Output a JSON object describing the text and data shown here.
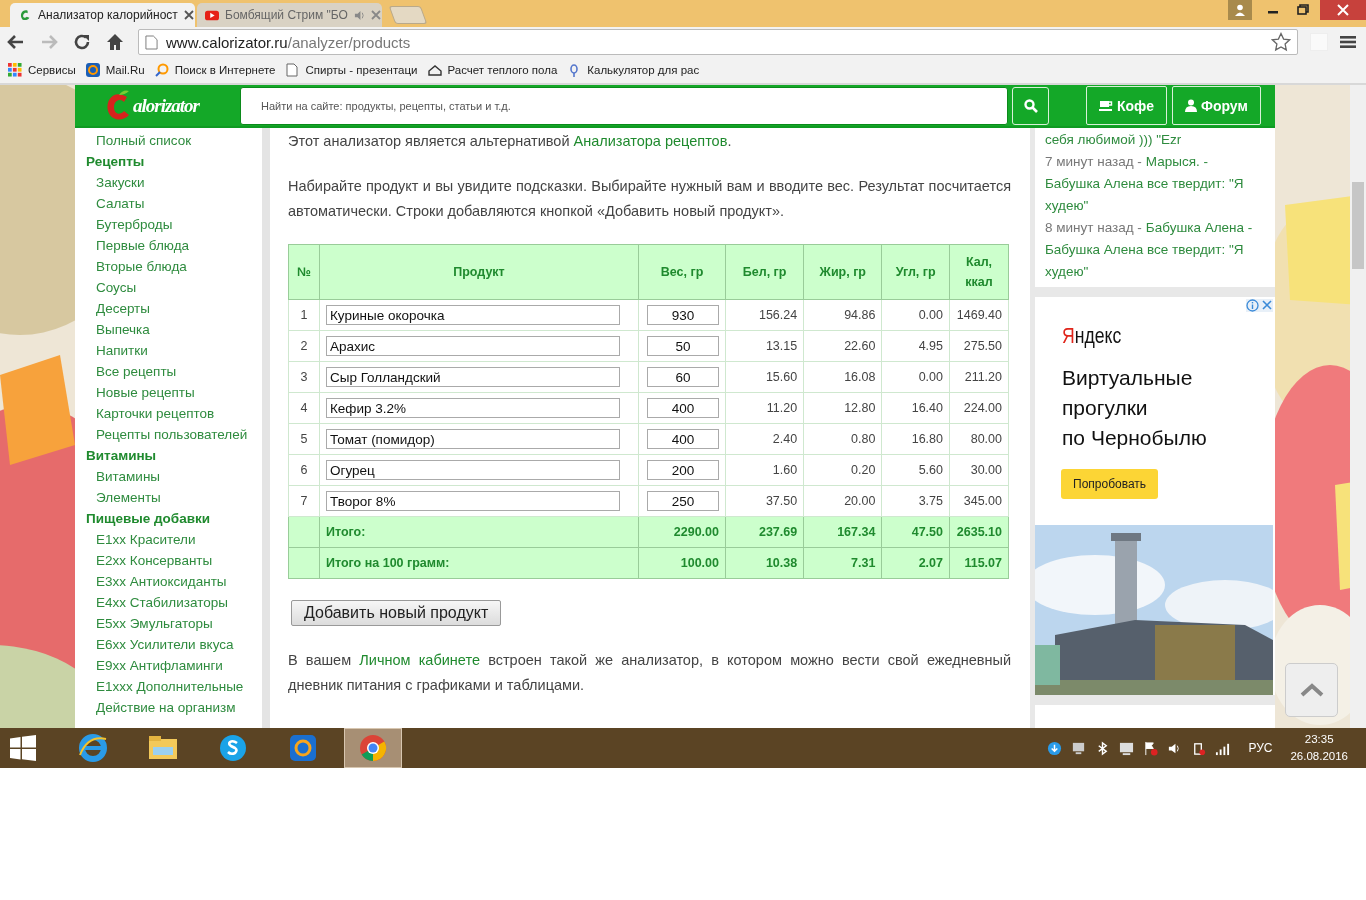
{
  "browser": {
    "tabs": [
      {
        "title": "Анализатор калорийност",
        "selected": true,
        "kind": "site",
        "audio": false
      },
      {
        "title": "Бомбящий Стрим \"БО",
        "selected": false,
        "kind": "video",
        "audio": true
      }
    ],
    "url": {
      "host": "www.calorizator.ru",
      "path": "/analyzer/products"
    },
    "bookmarks": [
      {
        "label": "Сервисы",
        "kind": "apps"
      },
      {
        "label": "Mail.Ru",
        "kind": "mail"
      },
      {
        "label": "Поиск в Интернете",
        "kind": "search"
      },
      {
        "label": "Спирты - презентаци",
        "kind": "doc"
      },
      {
        "label": "Расчет теплого пола",
        "kind": "floor"
      },
      {
        "label": "Калькулятор для рас",
        "kind": "pin"
      }
    ]
  },
  "site": {
    "logo_text": "alorizator",
    "search_placeholder": "Найти на сайте: продукты, рецепты, статьи и т.д.",
    "buttons": [
      {
        "label": "Кофе",
        "kind": "coffee"
      },
      {
        "label": "Форум",
        "kind": "user"
      }
    ]
  },
  "sidebar": [
    {
      "label": "Полный список",
      "kind": "link"
    },
    {
      "label": "Рецепты",
      "kind": "heading"
    },
    {
      "label": "Закуски",
      "kind": "link"
    },
    {
      "label": "Салаты",
      "kind": "link"
    },
    {
      "label": "Бутерброды",
      "kind": "link"
    },
    {
      "label": "Первые блюда",
      "kind": "link"
    },
    {
      "label": "Вторые блюда",
      "kind": "link"
    },
    {
      "label": "Соусы",
      "kind": "link"
    },
    {
      "label": "Десерты",
      "kind": "link"
    },
    {
      "label": "Выпечка",
      "kind": "link"
    },
    {
      "label": "Напитки",
      "kind": "link"
    },
    {
      "label": "Все рецепты",
      "kind": "link"
    },
    {
      "label": "Новые рецепты",
      "kind": "link"
    },
    {
      "label": "Карточки рецептов",
      "kind": "link"
    },
    {
      "label": "Рецепты пользователей",
      "kind": "link"
    },
    {
      "label": "Витамины",
      "kind": "heading"
    },
    {
      "label": "Витамины",
      "kind": "link"
    },
    {
      "label": "Элементы",
      "kind": "link"
    },
    {
      "label": "Пищевые добавки",
      "kind": "heading"
    },
    {
      "label": "E1xx Красители",
      "kind": "link"
    },
    {
      "label": "E2xx Консерванты",
      "kind": "link"
    },
    {
      "label": "E3xx Антиоксиданты",
      "kind": "link"
    },
    {
      "label": "E4xx Стабилизаторы",
      "kind": "link"
    },
    {
      "label": "E5xx Эмульгаторы",
      "kind": "link"
    },
    {
      "label": "E6xx Усилители вкуса",
      "kind": "link"
    },
    {
      "label": "E9xx Антифламинги",
      "kind": "link"
    },
    {
      "label": "E1xxx Дополнительные",
      "kind": "link"
    },
    {
      "label": "Действие на организм",
      "kind": "link"
    }
  ],
  "main": {
    "intro": {
      "before": "Этот анализатор является альтернативой ",
      "link": "Анализатора рецептов",
      "after": "."
    },
    "paragraph": "Набирайте продукт и вы увидите подсказки. Выбирайте нужный вам и вводите вес. Результат посчитается автоматически. Строки добавляются кнопкой «Добавить новый продукт».",
    "table": {
      "columns": [
        "№",
        "Продукт",
        "Вес, гр",
        "Бел, гр",
        "Жир, гр",
        "Угл, гр",
        "Кал, ккал"
      ],
      "rows": [
        {
          "num": "1",
          "product": "Куриные окорочка",
          "weight": "930",
          "protein": "156.24",
          "fat": "94.86",
          "carbs": "0.00",
          "kcal": "1469.40"
        },
        {
          "num": "2",
          "product": "Арахис",
          "weight": "50",
          "protein": "13.15",
          "fat": "22.60",
          "carbs": "4.95",
          "kcal": "275.50"
        },
        {
          "num": "3",
          "product": "Сыр Голландский",
          "weight": "60",
          "protein": "15.60",
          "fat": "16.08",
          "carbs": "0.00",
          "kcal": "211.20"
        },
        {
          "num": "4",
          "product": "Кефир 3.2%",
          "weight": "400",
          "protein": "11.20",
          "fat": "12.80",
          "carbs": "16.40",
          "kcal": "224.00"
        },
        {
          "num": "5",
          "product": "Томат (помидор)",
          "weight": "400",
          "protein": "2.40",
          "fat": "0.80",
          "carbs": "16.80",
          "kcal": "80.00"
        },
        {
          "num": "6",
          "product": "Огурец",
          "weight": "200",
          "protein": "1.60",
          "fat": "0.20",
          "carbs": "5.60",
          "kcal": "30.00"
        },
        {
          "num": "7",
          "product": "Творог 8%",
          "weight": "250",
          "protein": "37.50",
          "fat": "20.00",
          "carbs": "3.75",
          "kcal": "345.00"
        }
      ],
      "totals": [
        {
          "label": "Итого:",
          "weight": "2290.00",
          "protein": "237.69",
          "fat": "167.34",
          "carbs": "47.50",
          "kcal": "2635.10"
        },
        {
          "label": "Итого на 100 грамм:",
          "weight": "100.00",
          "protein": "10.38",
          "fat": "7.31",
          "carbs": "2.07",
          "kcal": "115.07"
        }
      ]
    },
    "add_button": "Добавить новый продукт",
    "footer": {
      "before": "В вашем ",
      "link": "Личном кабинете",
      "after": " встроен такой же анализатор, в котором можно вести свой ежедневный дневник питания с графиками и таблицами."
    }
  },
  "comments": {
    "cut_line": "себя любимой ))) \"Ezr",
    "items": [
      {
        "time": "7 минут назад -",
        "author": "Марыся. -",
        "title": "Бабушка Алена все твердит: \"Я худею\""
      },
      {
        "time": "8 минут назад -",
        "author": "Бабушка Алена -",
        "title": "Бабушка Алена все твердит: \"Я худею\""
      }
    ]
  },
  "ad": {
    "logo": "Яндекс",
    "headline": [
      "Виртуальные",
      "прогулки",
      "по Чернобылю"
    ],
    "button": "Попробовать",
    "kind": "picture"
  },
  "taskbar": {
    "apps": [
      {
        "kind": "ie",
        "selected": false
      },
      {
        "kind": "explorer",
        "selected": false
      },
      {
        "kind": "skype",
        "selected": false
      },
      {
        "kind": "mailagent",
        "selected": false
      },
      {
        "kind": "chrome",
        "selected": true
      }
    ],
    "language": "РУС",
    "time": "23:35",
    "date": "26.08.2016"
  }
}
